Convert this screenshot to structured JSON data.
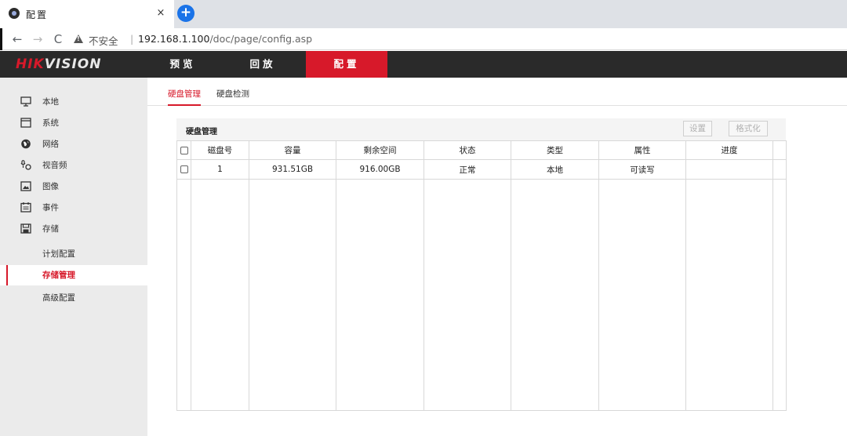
{
  "browser": {
    "tab_title": "配置",
    "tab_close": "×",
    "new_tab": "+",
    "nav_back": "←",
    "nav_forward": "→",
    "nav_reload": "C",
    "security_label": "不安全",
    "separator": "|",
    "url_host": "192.168.1.100",
    "url_path": "/doc/page/config.asp"
  },
  "header": {
    "logo_red": "HIK",
    "logo_rest": "VISION",
    "nav": [
      {
        "label": "预览"
      },
      {
        "label": "回放"
      },
      {
        "label": "配置"
      }
    ]
  },
  "sidebar": {
    "items": [
      {
        "label": "本地",
        "icon": "monitor-icon"
      },
      {
        "label": "系统",
        "icon": "system-icon"
      },
      {
        "label": "网络",
        "icon": "globe-icon"
      },
      {
        "label": "视音频",
        "icon": "audio-video-icon"
      },
      {
        "label": "图像",
        "icon": "image-icon"
      },
      {
        "label": "事件",
        "icon": "calendar-icon"
      },
      {
        "label": "存储",
        "icon": "save-icon"
      }
    ],
    "sub_items": [
      {
        "label": "计划配置"
      },
      {
        "label": "存储管理"
      },
      {
        "label": "高级配置"
      }
    ]
  },
  "subtabs": [
    {
      "label": "硬盘管理"
    },
    {
      "label": "硬盘检测"
    }
  ],
  "panel": {
    "title": "硬盘管理",
    "setup_button": "设置",
    "format_button": "格式化"
  },
  "table": {
    "columns": [
      "磁盘号",
      "容量",
      "剩余空间",
      "状态",
      "类型",
      "属性",
      "进度"
    ],
    "rows": [
      {
        "disk_no": "1",
        "capacity": "931.51GB",
        "free": "916.00GB",
        "status": "正常",
        "type": "本地",
        "attribute": "可读写",
        "progress": ""
      }
    ]
  },
  "colors": {
    "brand_red": "#d7192a",
    "header_bg": "#2a2a2a",
    "sidebar_bg": "#ebebeb"
  }
}
